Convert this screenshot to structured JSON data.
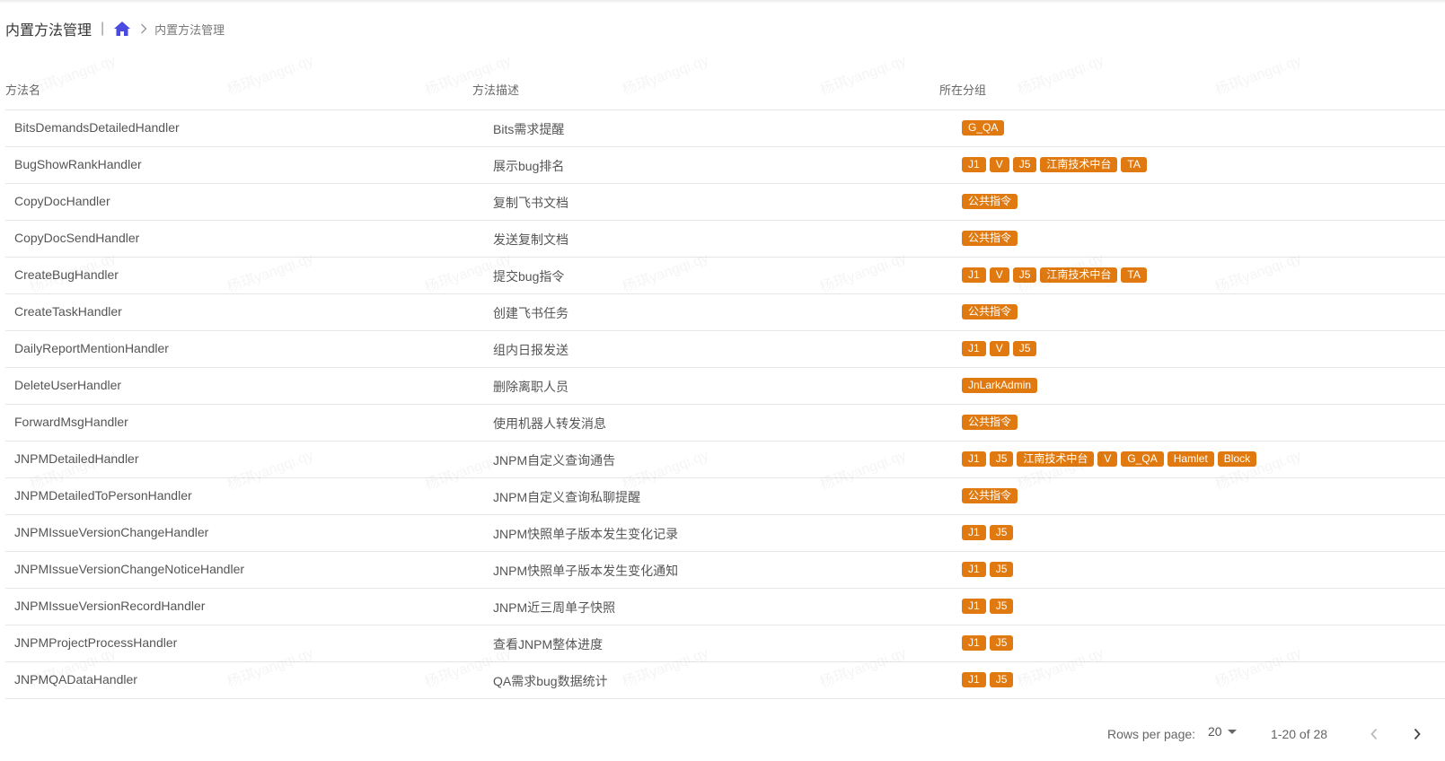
{
  "header": {
    "title": "内置方法管理",
    "separator": "|",
    "breadcrumb": "内置方法管理"
  },
  "table": {
    "columns": [
      "方法名",
      "方法描述",
      "所在分组"
    ],
    "rows": [
      {
        "name": "BitsDemandsDetailedHandler",
        "desc": "Bits需求提醒",
        "groups": [
          "G_QA"
        ]
      },
      {
        "name": "BugShowRankHandler",
        "desc": "展示bug排名",
        "groups": [
          "J1",
          "V",
          "J5",
          "江南技术中台",
          "TA"
        ]
      },
      {
        "name": "CopyDocHandler",
        "desc": "复制飞书文档",
        "groups": [
          "公共指令"
        ]
      },
      {
        "name": "CopyDocSendHandler",
        "desc": "发送复制文档",
        "groups": [
          "公共指令"
        ]
      },
      {
        "name": "CreateBugHandler",
        "desc": "提交bug指令",
        "groups": [
          "J1",
          "V",
          "J5",
          "江南技术中台",
          "TA"
        ]
      },
      {
        "name": "CreateTaskHandler",
        "desc": "创建飞书任务",
        "groups": [
          "公共指令"
        ]
      },
      {
        "name": "DailyReportMentionHandler",
        "desc": "组内日报发送",
        "groups": [
          "J1",
          "V",
          "J5"
        ]
      },
      {
        "name": "DeleteUserHandler",
        "desc": "删除离职人员",
        "groups": [
          "JnLarkAdmin"
        ]
      },
      {
        "name": "ForwardMsgHandler",
        "desc": "使用机器人转发消息",
        "groups": [
          "公共指令"
        ]
      },
      {
        "name": "JNPMDetailedHandler",
        "desc": "JNPM自定义查询通告",
        "groups": [
          "J1",
          "J5",
          "江南技术中台",
          "V",
          "G_QA",
          "Hamlet",
          "Block"
        ]
      },
      {
        "name": "JNPMDetailedToPersonHandler",
        "desc": "JNPM自定义查询私聊提醒",
        "groups": [
          "公共指令"
        ]
      },
      {
        "name": "JNPMIssueVersionChangeHandler",
        "desc": "JNPM快照单子版本发生变化记录",
        "groups": [
          "J1",
          "J5"
        ]
      },
      {
        "name": "JNPMIssueVersionChangeNoticeHandler",
        "desc": "JNPM快照单子版本发生变化通知",
        "groups": [
          "J1",
          "J5"
        ]
      },
      {
        "name": "JNPMIssueVersionRecordHandler",
        "desc": "JNPM近三周单子快照",
        "groups": [
          "J1",
          "J5"
        ]
      },
      {
        "name": "JNPMProjectProcessHandler",
        "desc": "查看JNPM整体进度",
        "groups": [
          "J1",
          "J5"
        ]
      },
      {
        "name": "JNPMQADataHandler",
        "desc": "QA需求bug数据统计",
        "groups": [
          "J1",
          "J5"
        ]
      }
    ]
  },
  "watermark": "杨琪yangqi.qy",
  "pagination": {
    "rows_per_page_label": "Rows per page:",
    "rows_per_page_value": "20",
    "range": "1-20 of 28"
  },
  "colors": {
    "tag": "#e07a10",
    "home_icon": "#4a4ae0"
  }
}
